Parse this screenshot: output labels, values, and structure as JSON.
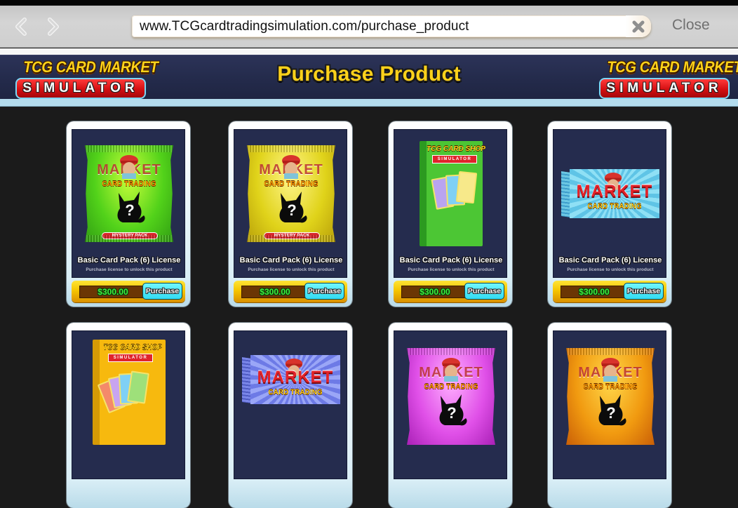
{
  "browser": {
    "url": "www.TCGcardtradingsimulation.com/purchase_product",
    "close_label": "Close",
    "icons": {
      "back": "chevron-left-icon",
      "forward": "chevron-right-icon",
      "clear": "clear-x-icon"
    }
  },
  "header": {
    "title": "Purchase Product",
    "logo": {
      "line1": "TCG CARD MARKET",
      "line2": "SIMULATOR"
    }
  },
  "products": [
    {
      "name": "Basic Card Pack (6) License",
      "description": "Purchase license to unlock this product",
      "price": "$300.00",
      "button": "Purchase",
      "art": "green-mystery-pack",
      "art_brand": "MARKET",
      "art_sub": "CARD TRADING",
      "art_label": "MYSTERY PACK"
    },
    {
      "name": "Basic Card Pack (6) License",
      "description": "Purchase license to unlock this product",
      "price": "$300.00",
      "button": "Purchase",
      "art": "yellow-mystery-pack",
      "art_brand": "MARKET",
      "art_sub": "CARD TRADING",
      "art_label": "MYSTERY PACK"
    },
    {
      "name": "Basic Card Pack (6) License",
      "description": "Purchase license to unlock this product",
      "price": "$300.00",
      "button": "Purchase",
      "art": "green-card-box",
      "art_brand": "TCG CARD SHOP",
      "art_sub": "SIMULATOR"
    },
    {
      "name": "Basic Card Pack (6) License",
      "description": "Purchase license to unlock this product",
      "price": "$300.00",
      "button": "Purchase",
      "art": "blue-wide-box",
      "art_brand": "MARKET",
      "art_sub": "CARD TRADING"
    },
    {
      "art": "yellow-card-box",
      "art_brand": "TCG CARD SHOP",
      "art_sub": "SIMULATOR"
    },
    {
      "art": "purple-wide-box",
      "art_brand": "MARKET",
      "art_sub": "CARD TRADING"
    },
    {
      "art": "magenta-mystery-pack",
      "art_brand": "MARKET",
      "art_sub": "CARD TRADING"
    },
    {
      "art": "orange-mystery-pack",
      "art_brand": "MARKET",
      "art_sub": "CARD TRADING"
    }
  ],
  "colors": {
    "banner_bg": "#232a4a",
    "title_yellow": "#ffd21a",
    "price_green": "#3df03d",
    "button_cyan": "#33dcf2",
    "page_bg": "#1b1b1b"
  }
}
